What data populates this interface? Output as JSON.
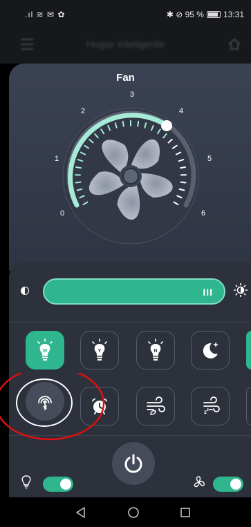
{
  "status_bar": {
    "signal_text": ".ıl ≋ ✉ ✿",
    "right_text": "✱ ⊘ 95 %",
    "battery_icon": "battery-icon",
    "time": "13:31"
  },
  "header": {
    "title": "Hogar inteligente",
    "menu_icon": "menu-icon",
    "home_icon": "home-icon"
  },
  "fan": {
    "title": "Fan",
    "speed_level": 4,
    "speed_max": 6,
    "dial_numbers": [
      "0",
      "1",
      "2",
      "3",
      "4",
      "5",
      "6"
    ],
    "accent": "#a6ebd7"
  },
  "brightness": {
    "left_icon": "contrast-icon",
    "right_icon": "sun-icon",
    "level_percent": 100,
    "grip": "III",
    "color": "#2fb68e"
  },
  "modes": [
    {
      "id": "white",
      "icon": "bulb-icon",
      "letter": "W",
      "active": true
    },
    {
      "id": "yellow",
      "icon": "bulb-icon",
      "letter": "Y",
      "active": false
    },
    {
      "id": "neutral",
      "icon": "bulb-icon",
      "letter": "N",
      "active": false
    },
    {
      "id": "night",
      "icon": "moon-star-icon",
      "letter": "",
      "active": false
    }
  ],
  "functions": [
    {
      "id": "bluetooth",
      "icon": "bluetooth-fingerprint-icon"
    },
    {
      "id": "alarm",
      "icon": "alarm-clock-icon"
    },
    {
      "id": "natural-wind",
      "icon": "leaf-wind-icon"
    },
    {
      "id": "sleep-wind",
      "icon": "sleep-wind-icon"
    }
  ],
  "bottom": {
    "light_toggle_on": true,
    "fan_toggle_on": true,
    "power_icon": "power-icon"
  },
  "annotation_color": "#e01010"
}
